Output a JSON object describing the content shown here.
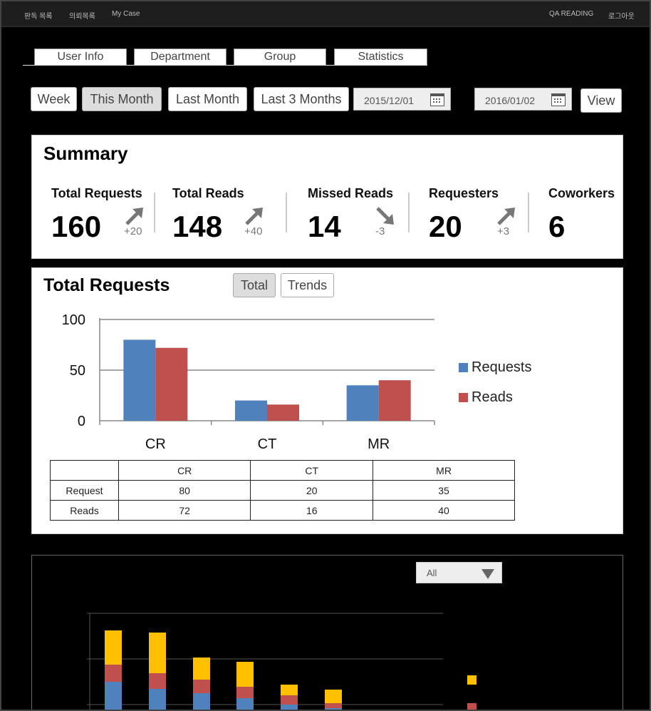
{
  "topbar": {
    "left_links": [
      "판독 목록",
      "의뢰목록",
      "My Case"
    ],
    "right_links": [
      "QA READING",
      "로그아웃"
    ]
  },
  "tabs": [
    "User Info",
    "Department",
    "Group",
    "Statistics"
  ],
  "filters": {
    "buttons": [
      "Week",
      "This Month",
      "Last Month",
      "Last 3 Months"
    ],
    "active": "This Month",
    "start_date": "2015/12/01",
    "end_date": "2016/01/02",
    "view_label": "View"
  },
  "summary": {
    "title": "Summary",
    "stats": [
      {
        "label": "Total Requests",
        "value": "160",
        "delta": "+20",
        "trend": "up"
      },
      {
        "label": "Total Reads",
        "value": "148",
        "delta": "+40",
        "trend": "up"
      },
      {
        "label": "Missed Reads",
        "value": "14",
        "delta": "-3",
        "trend": "down"
      },
      {
        "label": "Requesters",
        "value": "20",
        "delta": "+3",
        "trend": "up"
      },
      {
        "label": "Coworkers",
        "value": "6",
        "delta": "",
        "trend": ""
      }
    ]
  },
  "requests_panel": {
    "title": "Total Requests",
    "toggle": [
      "Total",
      "Trends"
    ],
    "toggle_active": "Total"
  },
  "chart_data": {
    "type": "bar",
    "categories": [
      "CR",
      "CT",
      "MR"
    ],
    "series": [
      {
        "name": "Requests",
        "values": [
          80,
          20,
          35
        ],
        "color": "#4f81bd"
      },
      {
        "name": "Reads",
        "values": [
          72,
          16,
          40
        ],
        "color": "#c0504d"
      }
    ],
    "yticks": [
      0,
      50,
      100
    ],
    "ylim": [
      0,
      100
    ],
    "legend": "right",
    "grid": true
  },
  "table": {
    "header": [
      "",
      "CR",
      "CT",
      "MR"
    ],
    "rows": [
      [
        "Request",
        "80",
        "20",
        "35"
      ],
      [
        "Reads",
        "72",
        "16",
        "40"
      ]
    ]
  },
  "lower_panel": {
    "filter_value": "All",
    "stack_colors": [
      "#4f81bd",
      "#c0504d",
      "#ffc000"
    ]
  }
}
